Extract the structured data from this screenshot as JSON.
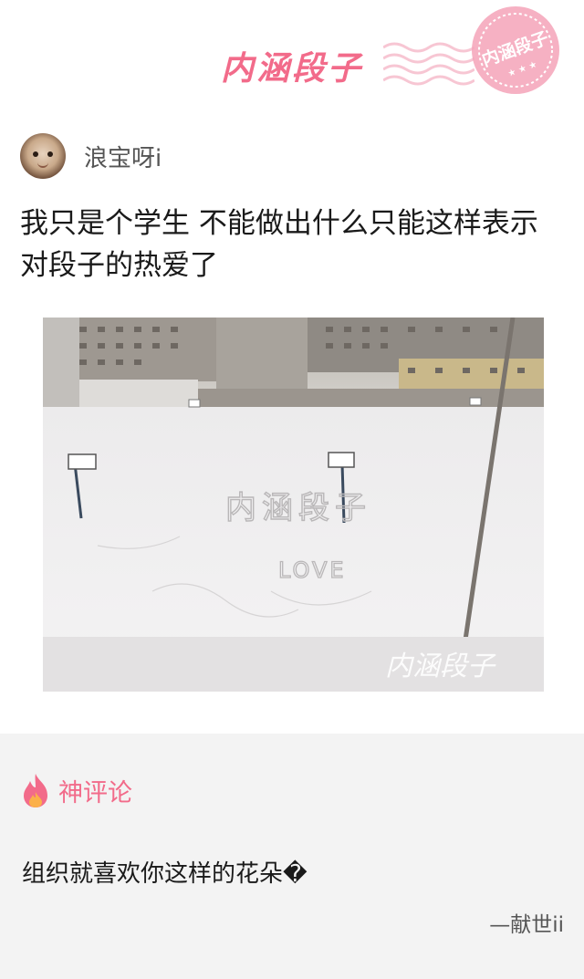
{
  "header": {
    "brand_title": "内涵段子",
    "stamp_text": "内涵段子"
  },
  "post": {
    "author": "浪宝呀i",
    "text": "我只是个学生 不能做出什么只能这样表示对段子的热爱了",
    "image": {
      "snow_writing": "内涵段子",
      "snow_love": "LOVE",
      "watermark": "内涵段子"
    }
  },
  "comments": {
    "section_label": "神评论",
    "top_comment": {
      "text": "组织就喜欢你这样的花朵�",
      "author": "—献世ii"
    }
  },
  "colors": {
    "brand": "#f26b8a",
    "comment_bg": "#f3f3f3"
  }
}
